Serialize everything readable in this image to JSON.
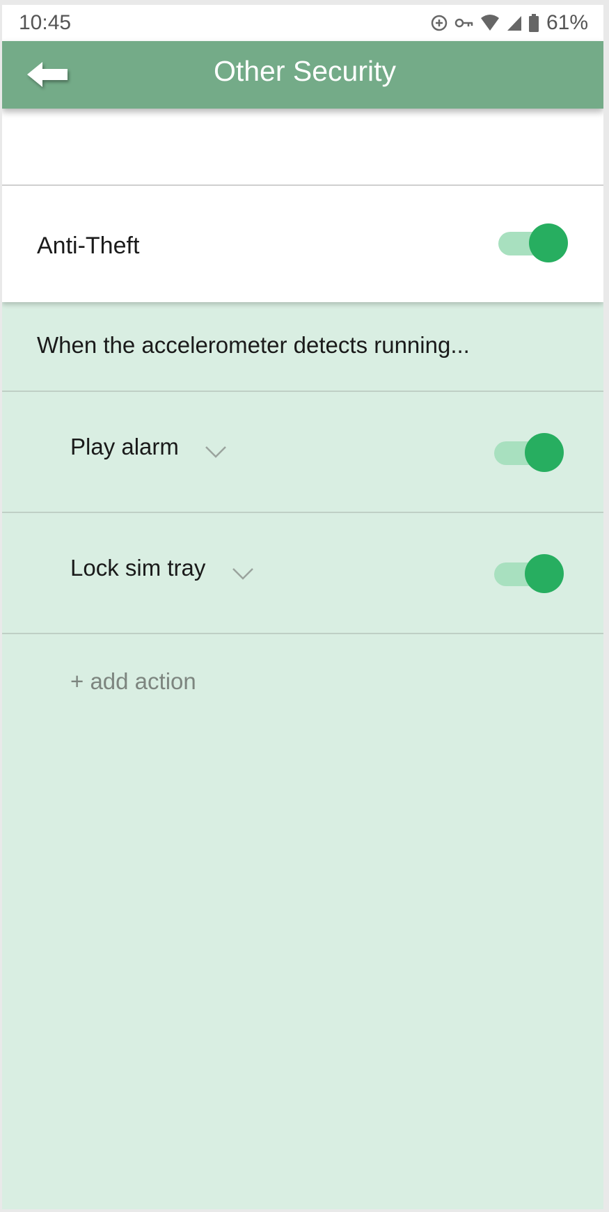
{
  "status_bar": {
    "time": "10:45",
    "battery": "61%",
    "icons": [
      "data-saver-icon",
      "vpn-key-icon",
      "wifi-icon",
      "cell-signal-icon",
      "battery-icon"
    ]
  },
  "app_bar": {
    "title": "Other Security",
    "back_icon": "back-arrow-icon",
    "color": "#74ab88"
  },
  "anti_theft": {
    "label": "Anti-Theft",
    "enabled": true
  },
  "trigger": {
    "description": "When the accelerometer detects running..."
  },
  "actions": [
    {
      "label": "Play alarm",
      "enabled": true
    },
    {
      "label": "Lock sim tray",
      "enabled": true
    }
  ],
  "add_action_label": "+ add action",
  "colors": {
    "accent": "#27ae60",
    "toggle_track": "#a8e0bf",
    "section_background": "#d9eee2"
  }
}
